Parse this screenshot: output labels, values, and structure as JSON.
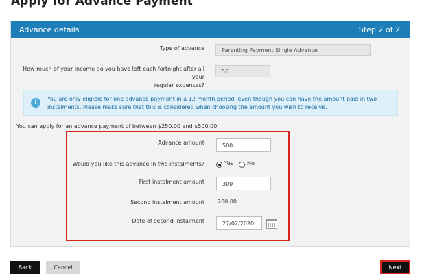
{
  "page": {
    "title": "Apply for Advance Payment"
  },
  "panel": {
    "title": "Advance details",
    "step": "Step 2 of 2"
  },
  "fields": {
    "type_label": "Type of advance",
    "type_value": "Parenting Payment Single Advance",
    "income_label_1": "How much of your income do you have left each fortnight after all your",
    "income_label_2": "regular expenses?",
    "income_value": "50"
  },
  "info": {
    "icon": "info-icon",
    "line1": "You are only eligible for one advance payment in a 12 month period, even though you can have the amount paid in two",
    "line2": "instalments. Please make sure that this is considered when choosing the amount you wish to receive."
  },
  "range_text": "You can apply for an advance payment of between $250.00 and $500.00.",
  "advance": {
    "amount_label": "Advance amount",
    "amount_value": "500",
    "two_instalments_label": "Would you like this advance in two instalments?",
    "yes_label": "Yes",
    "no_label": "No",
    "selected": "Yes",
    "first_label": "First instalment amount",
    "first_value": "300",
    "second_label": "Second instalment amount",
    "second_value": "200.00",
    "date_label": "Date of second instalment",
    "date_value": "27/02/2020",
    "calendar_icon": "calendar-icon"
  },
  "buttons": {
    "back": "Back",
    "cancel": "Cancel",
    "next": "Next"
  },
  "colors": {
    "header": "#1e7fb8",
    "highlight": "#d9251c",
    "info_bg": "#ddf0f9",
    "primary_button": "#111111"
  }
}
